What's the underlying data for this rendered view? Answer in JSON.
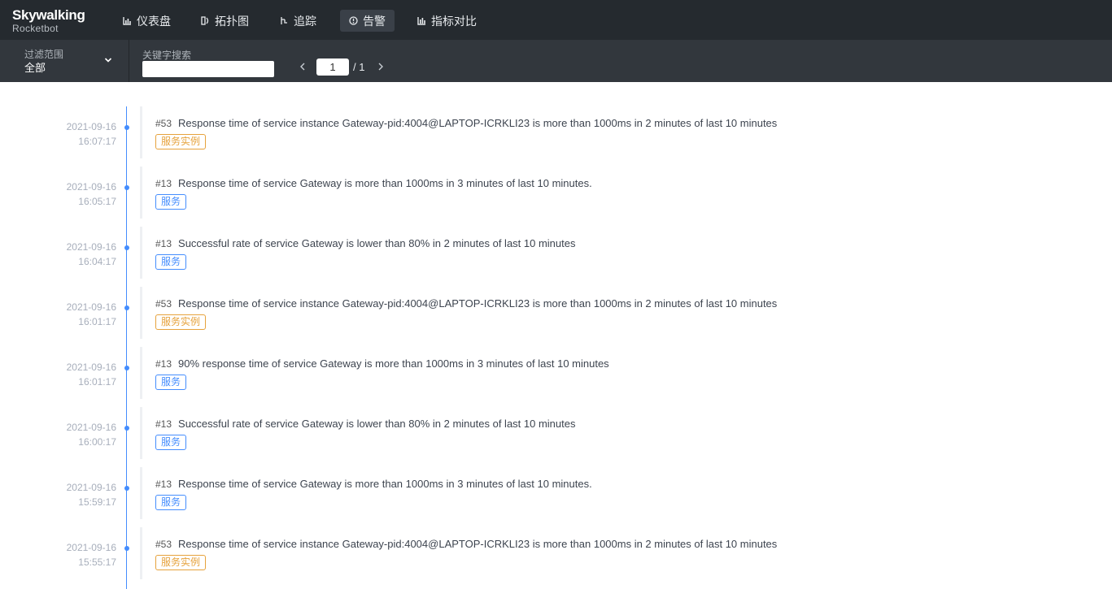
{
  "logo": {
    "main": "Skywalking",
    "sub": "Rocketbot"
  },
  "nav": [
    {
      "label": "仪表盘",
      "icon": "dashboard-icon",
      "active": false
    },
    {
      "label": "拓扑图",
      "icon": "topology-icon",
      "active": false
    },
    {
      "label": "追踪",
      "icon": "trace-icon",
      "active": false
    },
    {
      "label": "告警",
      "icon": "alarm-icon",
      "active": true
    },
    {
      "label": "指标对比",
      "icon": "comparison-icon",
      "active": false
    }
  ],
  "filter": {
    "scope_label": "过滤范围",
    "scope_value": "全部",
    "keyword_label": "关键字搜索",
    "keyword_value": "",
    "page_current": "1",
    "page_total": "/ 1"
  },
  "colors": {
    "accent": "#448dfe",
    "instance_tag": "#e6a23c",
    "nav_bg": "#252a2f",
    "filter_bg": "#32373d"
  },
  "alarms": [
    {
      "date": "2021-09-16",
      "time": "16:07:17",
      "id": "#53",
      "message": "Response time of service instance Gateway-pid:4004@LAPTOP-ICRKLI23 is more than 1000ms in 2 minutes of last 10 minutes",
      "tag": "服务实例",
      "kind": "instance"
    },
    {
      "date": "2021-09-16",
      "time": "16:05:17",
      "id": "#13",
      "message": "Response time of service Gateway is more than 1000ms in 3 minutes of last 10 minutes.",
      "tag": "服务",
      "kind": "service"
    },
    {
      "date": "2021-09-16",
      "time": "16:04:17",
      "id": "#13",
      "message": "Successful rate of service Gateway is lower than 80% in 2 minutes of last 10 minutes",
      "tag": "服务",
      "kind": "service"
    },
    {
      "date": "2021-09-16",
      "time": "16:01:17",
      "id": "#53",
      "message": "Response time of service instance Gateway-pid:4004@LAPTOP-ICRKLI23 is more than 1000ms in 2 minutes of last 10 minutes",
      "tag": "服务实例",
      "kind": "instance"
    },
    {
      "date": "2021-09-16",
      "time": "16:01:17",
      "id": "#13",
      "message": "90% response time of service Gateway is more than 1000ms in 3 minutes of last 10 minutes",
      "tag": "服务",
      "kind": "service"
    },
    {
      "date": "2021-09-16",
      "time": "16:00:17",
      "id": "#13",
      "message": "Successful rate of service Gateway is lower than 80% in 2 minutes of last 10 minutes",
      "tag": "服务",
      "kind": "service"
    },
    {
      "date": "2021-09-16",
      "time": "15:59:17",
      "id": "#13",
      "message": "Response time of service Gateway is more than 1000ms in 3 minutes of last 10 minutes.",
      "tag": "服务",
      "kind": "service"
    },
    {
      "date": "2021-09-16",
      "time": "15:55:17",
      "id": "#53",
      "message": "Response time of service instance Gateway-pid:4004@LAPTOP-ICRKLI23 is more than 1000ms in 2 minutes of last 10 minutes",
      "tag": "服务实例",
      "kind": "instance"
    }
  ]
}
